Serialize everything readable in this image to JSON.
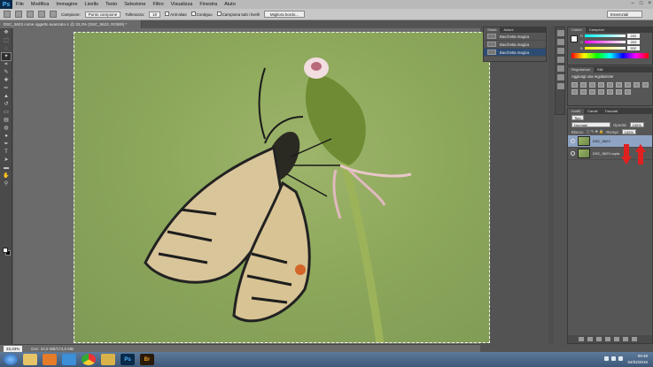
{
  "menubar": {
    "logo": "Ps",
    "items": [
      "File",
      "Modifica",
      "Immagine",
      "Livello",
      "Testo",
      "Selezione",
      "Filtro",
      "Visualizza",
      "Finestra",
      "Aiuto"
    ]
  },
  "options": {
    "campione_label": "Campione:",
    "campione_value": "Punto campione",
    "tolleranza_label": "Tolleranza:",
    "tolleranza_value": "10",
    "antialias_label": "Anti-alias",
    "contiguo_label": "Contiguo",
    "campiona_tutti_label": "Campiona tutti i livelli",
    "migliora_button": "Migliora bordo..."
  },
  "workspace": "Essenziali",
  "document": {
    "tab_title": "DSC_5623 come oggetto avanzato-1 @ 33,3% (DSC_5623, RGB/8) *",
    "zoom": "33,33%",
    "doc_info": "Doc: 34,9 MB/174,6 MB"
  },
  "history": {
    "tabs": [
      "Storia",
      "Azioni"
    ],
    "rows": [
      "Bacchetta magica",
      "Bacchetta magica",
      "Bacchetta magica"
    ]
  },
  "color_panel": {
    "tabs": [
      "Colore",
      "Campioni"
    ],
    "values": [
      "202",
      "202",
      "202"
    ]
  },
  "adjustments": {
    "tabs": [
      "Regolazioni",
      "Stili"
    ],
    "title": "Aggiungi una regolazione"
  },
  "layers": {
    "tabs": [
      "Livelli",
      "Canali",
      "Tracciati"
    ],
    "kind_filter": "Tipo",
    "blend_mode": "Normale",
    "opacity_label": "Opacità:",
    "opacity_value": "100%",
    "lock_label": "Blocca:",
    "fill_label": "Riempi:",
    "fill_value": "100%",
    "items": [
      "DSC_5623",
      "DSC_5623 copia"
    ]
  },
  "taskbar": {
    "apps": [
      "Ps",
      "Br"
    ],
    "time": "09:48",
    "date": "04/02/2016"
  },
  "colors": {
    "selection_highlight": "#2d4c73",
    "annotation_arrow": "#e02020"
  }
}
